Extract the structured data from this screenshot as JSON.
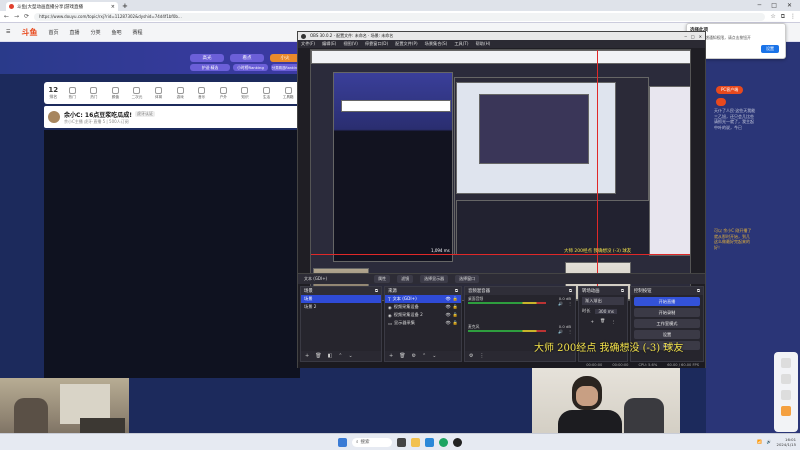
{
  "browser": {
    "tab_title": "斗鱼|大型动画直播分享|游戏直播",
    "url": "https://www.douyu.com/topic/rxj?rid=11287302&dyshid=74d4f1bf0b..."
  },
  "site": {
    "logo": "斗鱼",
    "nav": [
      "首页",
      "直播",
      "分类",
      "鱼吧",
      "赛程"
    ],
    "chips": [
      "高光",
      "看点",
      "小火"
    ],
    "chips2": [
      "护送·精选",
      "小时榜Ranking",
      "分类精选Ranking"
    ],
    "rank_number": "12",
    "rank_label": "排名",
    "categories": [
      "热门",
      "热门",
      "颜值",
      "二次元",
      "体育",
      "游戏",
      "音乐",
      "户外",
      "知识",
      "生活",
      "工具箱"
    ]
  },
  "post": {
    "title": "余小C: 16点豆浆吃瓜成!",
    "badge": "虎牙认证",
    "sub": "余小C主播  虎牙·直播  5 | 500人订阅"
  },
  "notify": {
    "title": "选择此项",
    "body": "浏览器新增通知权限，请点击按钮开启功能。",
    "button": "设置"
  },
  "right": {
    "btn1": "PC客户端",
    "text_lines": [
      "天仆了人民·这些天我能",
      "三乙旭，还只会几比些",
      "请抓光一就了，我主起",
      "中叶的说，今已"
    ],
    "yellow_lines": [
      "可以 余小C 刚开播了",
      "就从那时开始，到几",
      "这么做最好完起来的",
      "好！"
    ]
  },
  "obs": {
    "title": "OBS 30.0.2 · 配置文件: 未命名 · 场景: 未命名",
    "menu": [
      "文件(F)",
      "编辑(E)",
      "视图(V)",
      "停靠窗口(D)",
      "配置文件(P)",
      "场景集合(S)",
      "工具(T)",
      "帮助(H)"
    ],
    "source_bar": [
      "文本 (GDI+)",
      "属性",
      "滤镜",
      "选择显示器",
      "选择窗口"
    ],
    "scenes_title": "场景",
    "scenes": [
      "场景",
      "场景 2"
    ],
    "sources_title": "来源",
    "sources": [
      "文本 (GDI+)",
      "视频采集设备",
      "视频采集设备 2",
      "显示器采集"
    ],
    "mixer_title": "音频混音器",
    "mixer": [
      {
        "name": "桌面音频",
        "db": "0.0 dB"
      },
      {
        "name": "麦克风",
        "db": "0.0 dB"
      }
    ],
    "transitions_title": "转场动画",
    "transition_type": "渐入渐出",
    "duration_label": "时长",
    "duration": "300 ms",
    "controls_title": "控制按钮",
    "controls": [
      "开始直播",
      "开始录制",
      "工作室模式",
      "设置",
      "退出"
    ],
    "status": [
      "00:00:00",
      "00:00:00",
      "CPU: 5.6%",
      "60.00 / 60.00 FPS"
    ],
    "preview_label": "1,094 ms"
  },
  "subtitle": "大师 200经点 我确想没 (-3) 球友",
  "taskbar": {
    "search": "搜索",
    "time": "16:01",
    "date": "2024/1/15"
  }
}
